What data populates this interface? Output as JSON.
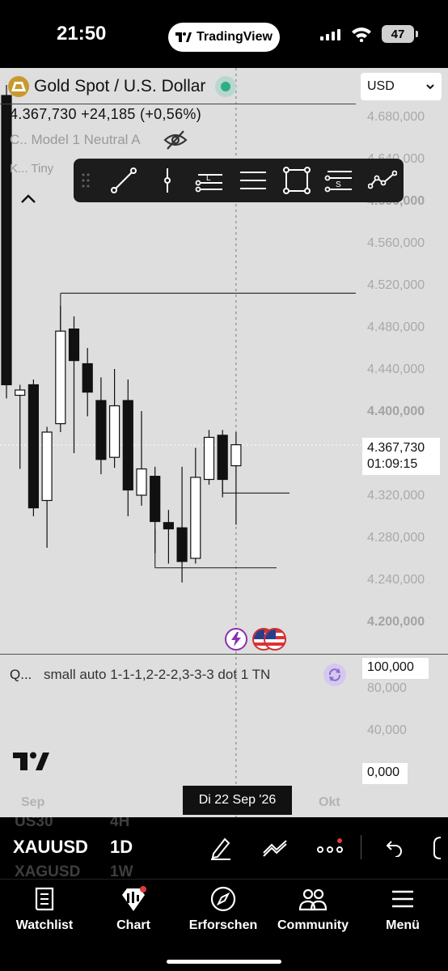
{
  "status_bar": {
    "time": "21:50",
    "app_pill": "TradingView",
    "battery": "47",
    "icons": [
      "signal-icon",
      "wifi-icon",
      "battery-icon"
    ]
  },
  "chart": {
    "symbol_title": "Gold Spot / U.S. Dollar",
    "price_line": "4.367,730  +24,185 (+0,56%)",
    "indicator_1": "C.. Model 1 Neutral A",
    "indicator_2": "K... Tiny",
    "currency": "USD",
    "price_axis": [
      "4.680,000",
      "4.640,000",
      "4.600,000",
      "4.560,000",
      "4.520,000",
      "4.480,000",
      "4.440,000",
      "4.400,000",
      "4.320,000",
      "4.280,000",
      "4.240,000",
      "4.200,000"
    ],
    "last_price": "4.367,730",
    "countdown": "01:09:15",
    "toolbar_tools": [
      "trend-line-icon",
      "vertical-line-icon",
      "horizontal-levels-icon",
      "parallel-lines-icon",
      "rectangle-icon",
      "settings-lines-icon",
      "path-icon"
    ],
    "colors": {
      "background": "#dedede",
      "candle_up": "#ffffff",
      "candle_down": "#111111",
      "live": "#2fae84",
      "events": "#8a2fb0"
    }
  },
  "chart_data": {
    "type": "candlestick",
    "title": "Gold Spot / U.S. Dollar",
    "ylim": [
      4200,
      4680
    ],
    "y_unit": "USD",
    "candles": [
      {
        "o": 4700,
        "h": 4710,
        "l": 4412,
        "c": 4425
      },
      {
        "o": 4415,
        "h": 4425,
        "l": 4345,
        "c": 4420
      },
      {
        "o": 4425,
        "h": 4430,
        "l": 4300,
        "c": 4308
      },
      {
        "o": 4315,
        "h": 4385,
        "l": 4270,
        "c": 4380
      },
      {
        "o": 4388,
        "h": 4500,
        "l": 4380,
        "c": 4476
      },
      {
        "o": 4478,
        "h": 4490,
        "l": 4360,
        "c": 4448
      },
      {
        "o": 4445,
        "h": 4460,
        "l": 4395,
        "c": 4418
      },
      {
        "o": 4410,
        "h": 4432,
        "l": 4340,
        "c": 4354
      },
      {
        "o": 4356,
        "h": 4440,
        "l": 4346,
        "c": 4405
      },
      {
        "o": 4410,
        "h": 4430,
        "l": 4300,
        "c": 4325
      },
      {
        "o": 4320,
        "h": 4400,
        "l": 4310,
        "c": 4345
      },
      {
        "o": 4338,
        "h": 4347,
        "l": 4265,
        "c": 4295
      },
      {
        "o": 4294,
        "h": 4306,
        "l": 4255,
        "c": 4288
      },
      {
        "o": 4289,
        "h": 4347,
        "l": 4237,
        "c": 4257
      },
      {
        "o": 4260,
        "h": 4365,
        "l": 4255,
        "c": 4337
      },
      {
        "o": 4335,
        "h": 4382,
        "l": 4330,
        "c": 4375
      },
      {
        "o": 4377,
        "h": 4382,
        "l": 4318,
        "c": 4335
      },
      {
        "o": 4348,
        "h": 4380,
        "l": 4292,
        "c": 4368
      }
    ],
    "levels": [
      4512,
      4322,
      4251
    ]
  },
  "panel": {
    "indicator_short": "Q...",
    "indicator_desc": "small auto 1-1-1,2-2-2,3-3-3 dot 1 TN",
    "axis": [
      "100,000",
      "80,000",
      "40,000",
      "0,000"
    ]
  },
  "x_axis": {
    "labels": [
      "Sep",
      "Okt"
    ],
    "crosshair_date": "Di 22 Sep '26"
  },
  "symbol_bar": {
    "symbol": "XAUUSD",
    "timeframe": "1D",
    "ghost_above": [
      "US30",
      "4H"
    ],
    "ghost_below": [
      "XAGUSD",
      "1W"
    ],
    "buttons": [
      "pen-icon",
      "drawings-icon",
      "more-icon",
      "undo-icon",
      "redo-icon"
    ]
  },
  "tabs": [
    {
      "label": "Watchlist",
      "icon": "watchlist-icon"
    },
    {
      "label": "Chart",
      "icon": "chart-icon"
    },
    {
      "label": "Erforschen",
      "icon": "compass-icon"
    },
    {
      "label": "Community",
      "icon": "community-icon"
    },
    {
      "label": "Menü",
      "icon": "menu-icon"
    }
  ]
}
